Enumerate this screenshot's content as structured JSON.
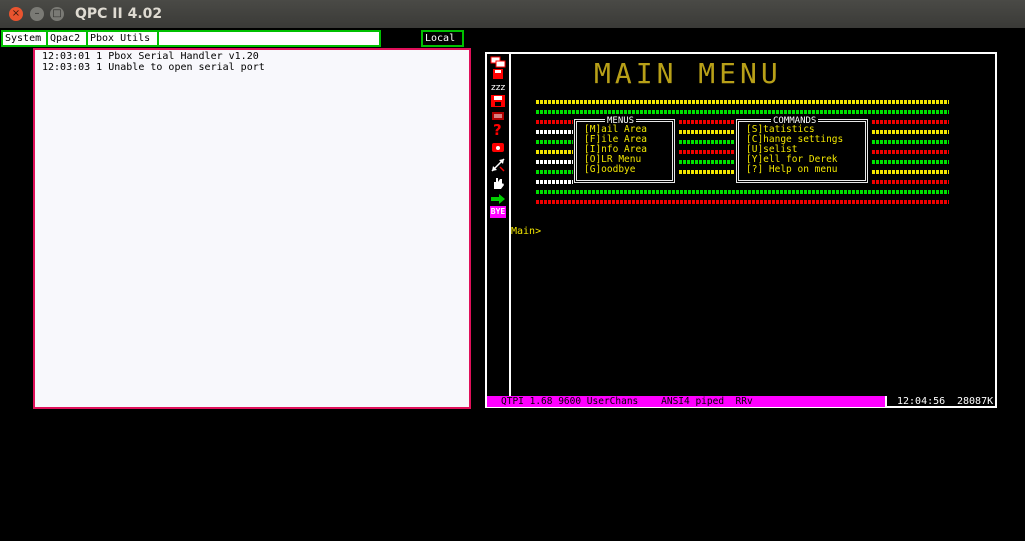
{
  "window": {
    "title": "QPC II 4.02",
    "close_glyph": "×",
    "min_glyph": "–",
    "max_glyph": "□"
  },
  "buttonbar": {
    "system": "System",
    "qpac2": "Qpac2",
    "pbox_utils": "Pbox Utils",
    "local": "Local",
    "input_value": ""
  },
  "console": {
    "lines": [
      "12:03:01 1 Pbox Serial Handler v1.20",
      "12:03:03 1 Unable to open serial port"
    ]
  },
  "terminal": {
    "title": "MAIN MENU",
    "menus_box": {
      "title": "MENUS",
      "items": [
        "[M]ail Area",
        "[F]ile Area",
        "[I]nfo Area",
        "[O]LR Menu",
        "[G]oodbye"
      ]
    },
    "commands_box": {
      "title": "COMMANDS",
      "items": [
        "[S]tatistics",
        "[C]hange settings",
        "[U]selist",
        "[Y]ell for Derek",
        "[?] Help on menu"
      ]
    },
    "prompt": "Main>",
    "toolbar_icons": [
      "windows-icon",
      "floppy-stack-icon",
      "sleep-zzz-icon",
      "save-disk-icon",
      "scroll-icon",
      "help-question-icon",
      "phone-icon",
      "resize-arrows-icon",
      "hand-icon",
      "arrow-right-icon",
      "bye-icon"
    ],
    "bye_label": "BYE",
    "status_left": "QTPI 1.68 9600 UserChans    ANSI4 piped  RRv",
    "status_time": "12:04:56",
    "status_mem": "28087K"
  },
  "colors": {
    "accent_green": "#00c000",
    "magenta": "#ff00ff",
    "menu_yellow": "#f2e600",
    "console_border": "#e0105a"
  }
}
